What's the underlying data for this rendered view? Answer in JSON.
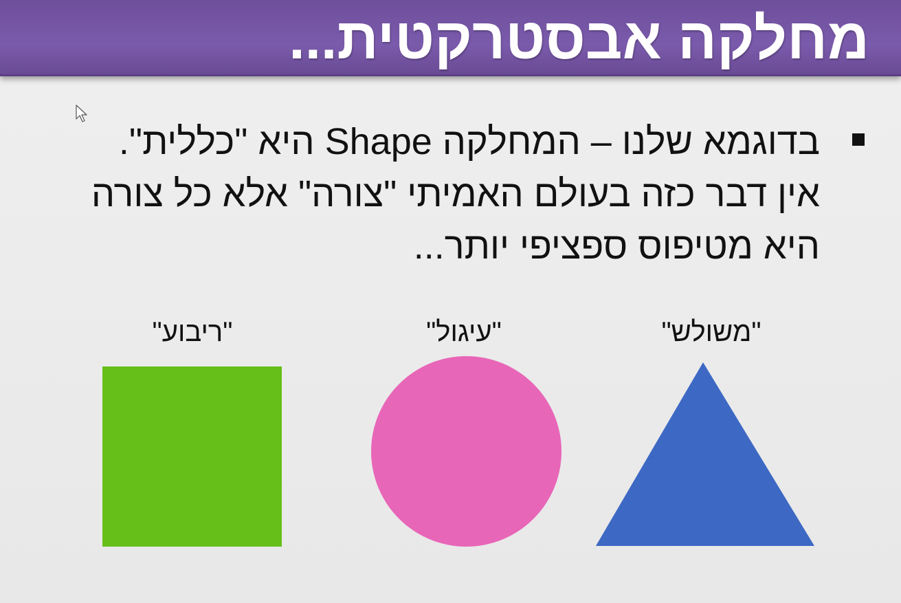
{
  "slide": {
    "title": "מחלקה אבסטרקטית...",
    "bullet": {
      "lines": [
        "בדוגמא שלנו – המחלקה Shape היא \"כללית\".",
        "אין דבר כזה בעולם האמיתי \"צורה\" אלא כל צורה",
        "היא מטיפוס ספציפי יותר..."
      ]
    },
    "shapes": [
      {
        "label": "\"ריבוע\"",
        "icon": "square-shape",
        "color": "#66be18"
      },
      {
        "label": "\"עיגול\"",
        "icon": "circle-shape",
        "color": "#e866b8"
      },
      {
        "label": "\"משולש\"",
        "icon": "triangle-shape",
        "color": "#3d68c4"
      }
    ]
  },
  "colors": {
    "title_bar": "#7a5aab",
    "title_text": "#ffffff",
    "background": "#ebebeb",
    "body_text": "#111111"
  }
}
